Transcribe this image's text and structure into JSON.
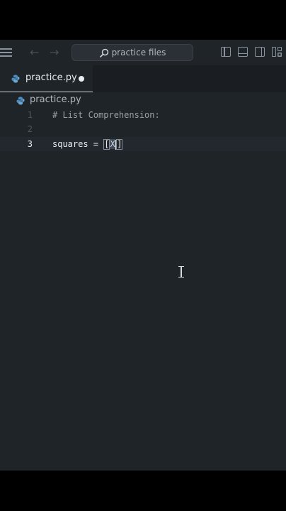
{
  "search": {
    "label": "practice files"
  },
  "tab": {
    "label": "practice.py"
  },
  "breadcrumb": {
    "file": "practice.py"
  },
  "editor": {
    "lines": [
      {
        "number": "1",
        "text": "# List Comprehension:"
      },
      {
        "number": "2",
        "text": ""
      },
      {
        "number": "3",
        "text_before": "squares = ",
        "bracket_open": "[",
        "selected": "X",
        "bracket_close": "]"
      }
    ],
    "active_line": 3
  },
  "icons": [
    "menu-icon",
    "arrow-left-icon",
    "arrow-right-icon",
    "search-icon",
    "toggle-primary-sidebar-icon",
    "toggle-panel-icon",
    "toggle-secondary-sidebar-icon",
    "customize-layout-icon",
    "python-file-icon",
    "unsaved-dot-icon",
    "text-cursor-icon"
  ],
  "colors": {
    "background": "#1f2428",
    "text": "#e6edf3",
    "comment": "#9aa1a8"
  }
}
